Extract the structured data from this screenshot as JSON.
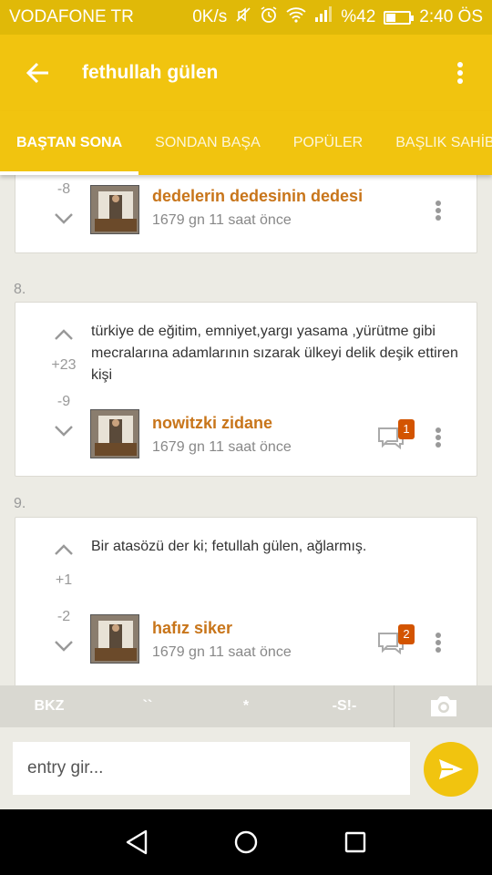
{
  "status_bar": {
    "carrier": "VODAFONE TR",
    "speed": "0K/s",
    "battery": "%42",
    "battery_level": 0.42,
    "time": "2:40 ÖS"
  },
  "app_bar": {
    "title": "fethullah gülen"
  },
  "tabs": [
    {
      "label": "BAŞTAN SONA",
      "active": true
    },
    {
      "label": "SONDAN BAŞA",
      "active": false
    },
    {
      "label": "POPÜLER",
      "active": false
    },
    {
      "label": "BAŞLIK SAHİBİ",
      "active": false
    }
  ],
  "entries": [
    {
      "number": "",
      "text": "",
      "upvotes": "",
      "downvotes": "-8",
      "author": "dedelerin dedesinin dedesi",
      "time": "1679 gn 11 saat  önce",
      "comments": ""
    },
    {
      "number": "8.",
      "text": "türkiye de eğitim, emniyet,yargı yasama ,yürütme gibi mecralarına adamlarının sızarak ülkeyi delik deşik ettiren kişi",
      "upvotes": "+23",
      "downvotes": "-9",
      "author": "nowitzki  zidane",
      "time": "1679 gn 11 saat  önce",
      "comments": "1"
    },
    {
      "number": "9.",
      "text": "Bir atasözü der ki; fetullah gülen, ağlarmış.",
      "upvotes": "+1",
      "downvotes": "-2",
      "author": "hafız siker",
      "time": "1679 gn 11 saat  önce",
      "comments": "2"
    }
  ],
  "format_bar": {
    "bkz": "BKZ",
    "backtick": "``",
    "star": "*",
    "spoiler": "-S!-"
  },
  "input": {
    "placeholder": "entry gir...",
    "value": ""
  },
  "colors": {
    "primary": "#f1c40f",
    "status_bar": "#e0b908",
    "author": "#c8751a",
    "badge": "#d35400"
  }
}
